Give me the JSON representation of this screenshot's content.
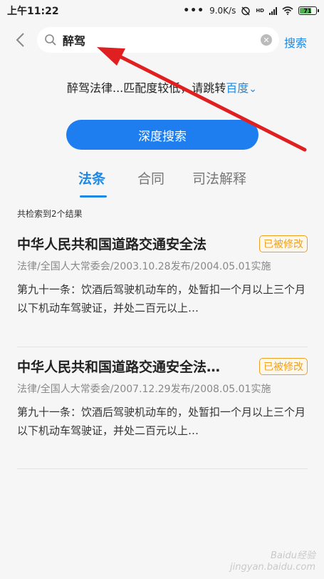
{
  "status": {
    "time": "上午11:22",
    "dots": "•••",
    "speed": "9.0K/s",
    "hd": "HD",
    "battery": "71"
  },
  "search": {
    "query": "醉驾",
    "button_label": "搜索"
  },
  "hint": {
    "text": "醉驾法律...匹配度较低，请跳转",
    "link": "百度",
    "chevron": "⌄"
  },
  "deep_search_label": "深度搜索",
  "tabs": [
    {
      "label": "法条",
      "active": true
    },
    {
      "label": "合同",
      "active": false
    },
    {
      "label": "司法解释",
      "active": false
    }
  ],
  "result_count": "共检索到2个结果",
  "results": [
    {
      "title": "中华人民共和国道路交通安全法",
      "badge": "已被修改",
      "meta": "法律/全国人大常委会/2003.10.28发布/2004.05.01实施",
      "body": "第九十一条：饮酒后驾驶机动车的，处暂扣一个月以上三个月以下机动车驾驶证，并处二百元以上…"
    },
    {
      "title": "中华人民共和国道路交通安全法…",
      "badge": "已被修改",
      "meta": "法律/全国人大常委会/2007.12.29发布/2008.05.01实施",
      "body": "第九十一条：饮酒后驾驶机动车的，处暂扣一个月以上三个月以下机动车驾驶证，并处二百元以上…"
    }
  ],
  "watermark": {
    "line1": "Baidu经验",
    "line2": "jingyan.baidu.com"
  },
  "colors": {
    "accent": "#1e88e5",
    "button": "#1e7ef0",
    "badge": "#f0a020",
    "annotation_arrow": "#e02020"
  }
}
